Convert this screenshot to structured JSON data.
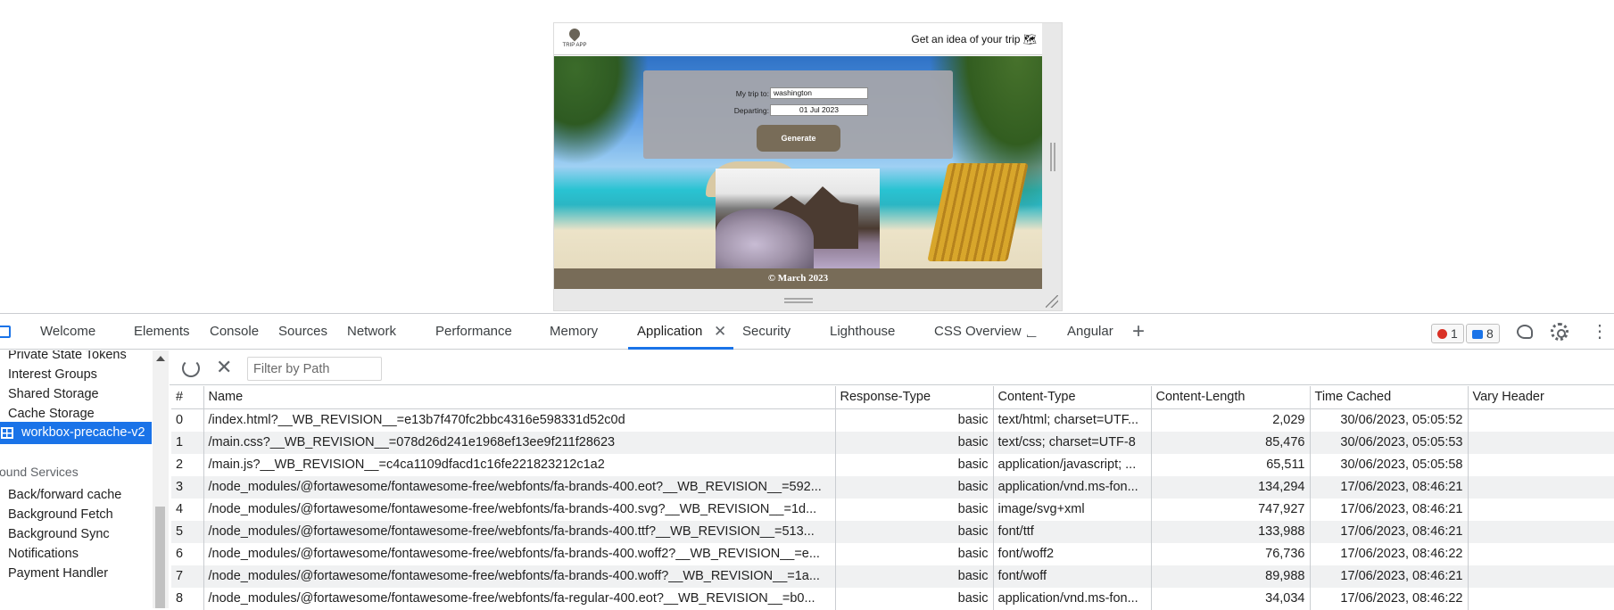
{
  "app": {
    "logo_text": "TRIP APP",
    "tagline": "Get an idea of your trip 🗺",
    "form": {
      "trip_label": "My trip to:",
      "trip_value": "washington",
      "departing_label": "Departing:",
      "departing_value": "01 Jul 2023",
      "generate_label": "Generate"
    },
    "footer": "© March 2023"
  },
  "devtools": {
    "tabs": {
      "welcome": "Welcome",
      "elements": "Elements",
      "console": "Console",
      "sources": "Sources",
      "network": "Network",
      "performance": "Performance",
      "memory": "Memory",
      "application": "Application",
      "security": "Security",
      "lighthouse": "Lighthouse",
      "css_overview": "CSS Overview",
      "angular": "Angular"
    },
    "error_count": "1",
    "message_count": "8",
    "sidebar": {
      "items": [
        "Private State Tokens",
        "Interest Groups",
        "Shared Storage",
        "Cache Storage",
        "workbox-precache-v2",
        "Back/forward cache",
        "Background Fetch",
        "Background Sync",
        "Notifications",
        "Payment Handler"
      ],
      "section_background": "ound Services"
    },
    "toolbar": {
      "filter_placeholder": "Filter by Path"
    },
    "table": {
      "headers": [
        "#",
        "Name",
        "Response-Type",
        "Content-Type",
        "Content-Length",
        "Time Cached",
        "Vary Header"
      ],
      "rows": [
        [
          "0",
          "/index.html?__WB_REVISION__=e13b7f470fc2bbc4316e598331d52c0d",
          "basic",
          "text/html; charset=UTF...",
          "2,029",
          "30/06/2023, 05:05:52",
          ""
        ],
        [
          "1",
          "/main.css?__WB_REVISION__=078d26d241e1968ef13ee9f211f28623",
          "basic",
          "text/css; charset=UTF-8",
          "85,476",
          "30/06/2023, 05:05:53",
          ""
        ],
        [
          "2",
          "/main.js?__WB_REVISION__=c4ca1109dfacd1c16fe221823212c1a2",
          "basic",
          "application/javascript; ...",
          "65,511",
          "30/06/2023, 05:05:58",
          ""
        ],
        [
          "3",
          "/node_modules/@fortawesome/fontawesome-free/webfonts/fa-brands-400.eot?__WB_REVISION__=592...",
          "basic",
          "application/vnd.ms-fon...",
          "134,294",
          "17/06/2023, 08:46:21",
          ""
        ],
        [
          "4",
          "/node_modules/@fortawesome/fontawesome-free/webfonts/fa-brands-400.svg?__WB_REVISION__=1d...",
          "basic",
          "image/svg+xml",
          "747,927",
          "17/06/2023, 08:46:21",
          ""
        ],
        [
          "5",
          "/node_modules/@fortawesome/fontawesome-free/webfonts/fa-brands-400.ttf?__WB_REVISION__=513...",
          "basic",
          "font/ttf",
          "133,988",
          "17/06/2023, 08:46:21",
          ""
        ],
        [
          "6",
          "/node_modules/@fortawesome/fontawesome-free/webfonts/fa-brands-400.woff2?__WB_REVISION__=e...",
          "basic",
          "font/woff2",
          "76,736",
          "17/06/2023, 08:46:22",
          ""
        ],
        [
          "7",
          "/node_modules/@fortawesome/fontawesome-free/webfonts/fa-brands-400.woff?__WB_REVISION__=1a...",
          "basic",
          "font/woff",
          "89,988",
          "17/06/2023, 08:46:21",
          ""
        ],
        [
          "8",
          "/node_modules/@fortawesome/fontawesome-free/webfonts/fa-regular-400.eot?__WB_REVISION__=b0...",
          "basic",
          "application/vnd.ms-fon...",
          "34,034",
          "17/06/2023, 08:46:22",
          ""
        ]
      ]
    }
  },
  "colors": {
    "accent": "#1a73e8",
    "app_brown": "#786c58",
    "error": "#d93025"
  }
}
